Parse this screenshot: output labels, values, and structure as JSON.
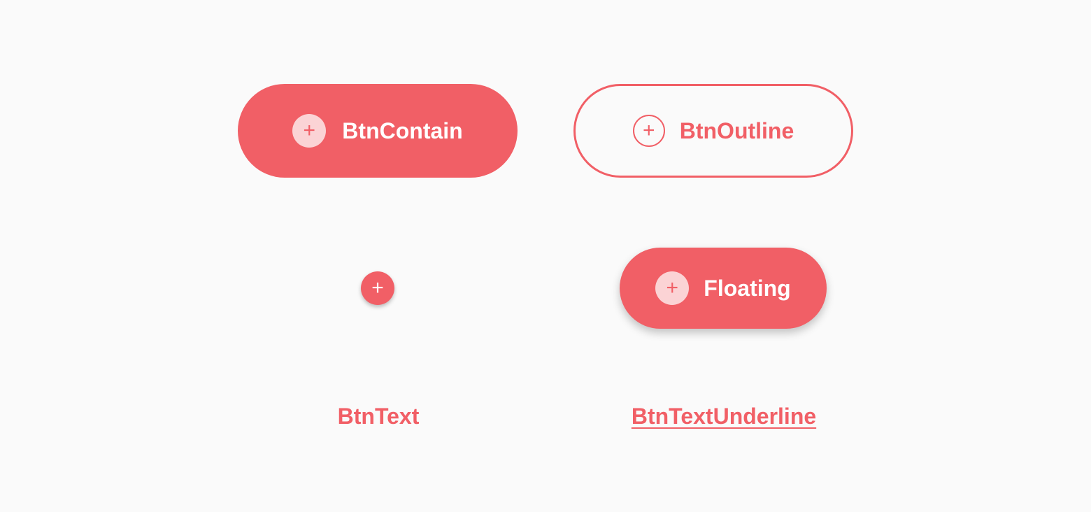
{
  "colors": {
    "primary": "#f15f66",
    "icon_bg_light": "#fbd3d5",
    "on_primary": "#ffffff",
    "background": "#fafafa"
  },
  "buttons": {
    "contain": {
      "label": "BtnContain",
      "icon": "plus-icon",
      "icon_glyph": "+"
    },
    "outline": {
      "label": "BtnOutline",
      "icon": "plus-icon",
      "icon_glyph": "+"
    },
    "icon_round": {
      "icon": "plus-icon",
      "icon_glyph": "+"
    },
    "floating": {
      "label": "Floating",
      "icon": "plus-icon",
      "icon_glyph": "+"
    },
    "text": {
      "label": "BtnText"
    },
    "text_underline": {
      "label": "BtnTextUnderline"
    }
  }
}
